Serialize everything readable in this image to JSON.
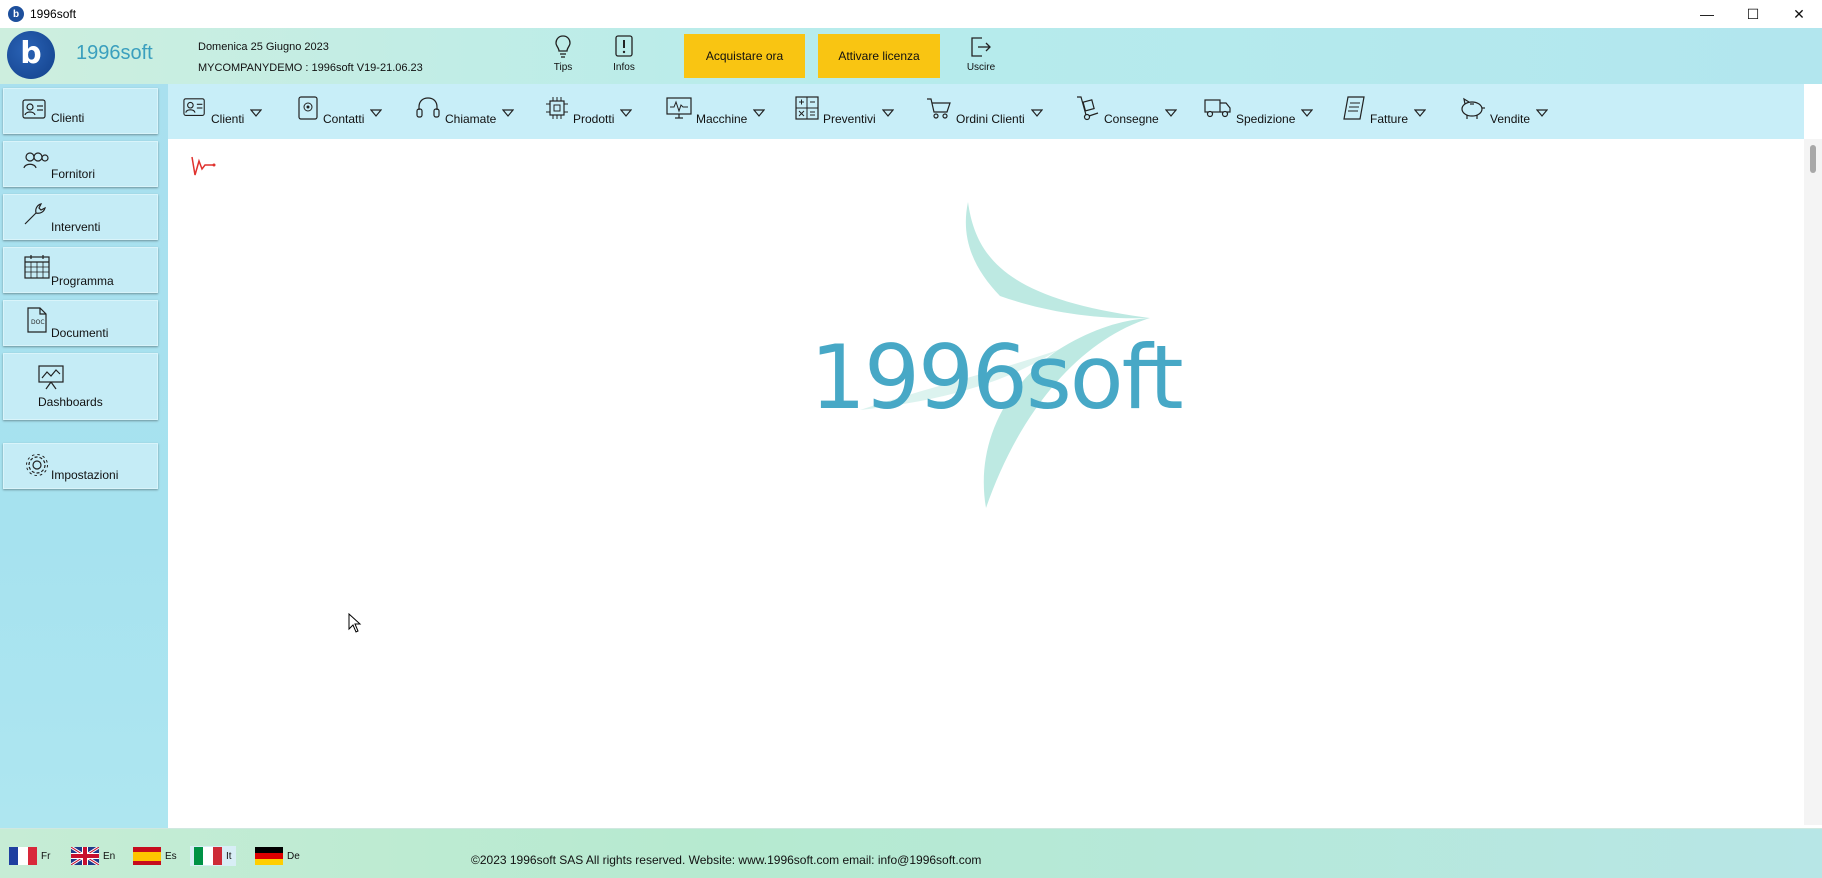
{
  "window": {
    "title": "1996soft",
    "controls": {
      "minimize": "—",
      "maximize": "☐",
      "close": "✕"
    }
  },
  "header": {
    "logo_letter": "b",
    "logo_text": "1996soft",
    "date": "Domenica 25 Giugno 2023",
    "company": "MYCOMPANYDEMO : 1996soft V19-21.06.23",
    "tips_label": "Tips",
    "infos_label": "Infos",
    "buy_label": "Acquistare ora",
    "activate_label": "Attivare licenza",
    "exit_label": "Uscire",
    "accent_color": "#f9c512"
  },
  "sidebar": {
    "items": [
      {
        "label": "Clienti",
        "icon": "contact-card-icon"
      },
      {
        "label": "Fornitori",
        "icon": "people-icon"
      },
      {
        "label": "Interventi",
        "icon": "wrench-icon"
      },
      {
        "label": "Programma",
        "icon": "calendar-icon"
      },
      {
        "label": "Documenti",
        "icon": "document-icon"
      },
      {
        "label": "Dashboards",
        "icon": "presentation-icon"
      },
      {
        "label": "Impostazioni",
        "icon": "gear-icon"
      }
    ]
  },
  "menubar": {
    "items": [
      {
        "label": "Clienti",
        "icon": "contact-card-icon"
      },
      {
        "label": "Contatti",
        "icon": "address-book-icon"
      },
      {
        "label": "Chiamate",
        "icon": "headset-icon"
      },
      {
        "label": "Prodotti",
        "icon": "chip-icon"
      },
      {
        "label": "Macchine",
        "icon": "monitor-icon"
      },
      {
        "label": "Preventivi",
        "icon": "calculator-icon"
      },
      {
        "label": "Ordini Clienti",
        "icon": "cart-icon"
      },
      {
        "label": "Consegne",
        "icon": "hand-truck-icon"
      },
      {
        "label": "Spedizione",
        "icon": "truck-icon"
      },
      {
        "label": "Fatture",
        "icon": "invoice-icon"
      },
      {
        "label": "Vendite",
        "icon": "piggy-bank-icon"
      }
    ]
  },
  "main": {
    "logo_text": "1996soft"
  },
  "footer": {
    "languages": [
      {
        "code": "Fr"
      },
      {
        "code": "En"
      },
      {
        "code": "Es"
      },
      {
        "code": "It",
        "active": true
      },
      {
        "code": "De"
      }
    ],
    "copyright": "©2023 1996soft SAS All rights reserved. Website: www.1996soft.com email: info@1996soft.com"
  }
}
